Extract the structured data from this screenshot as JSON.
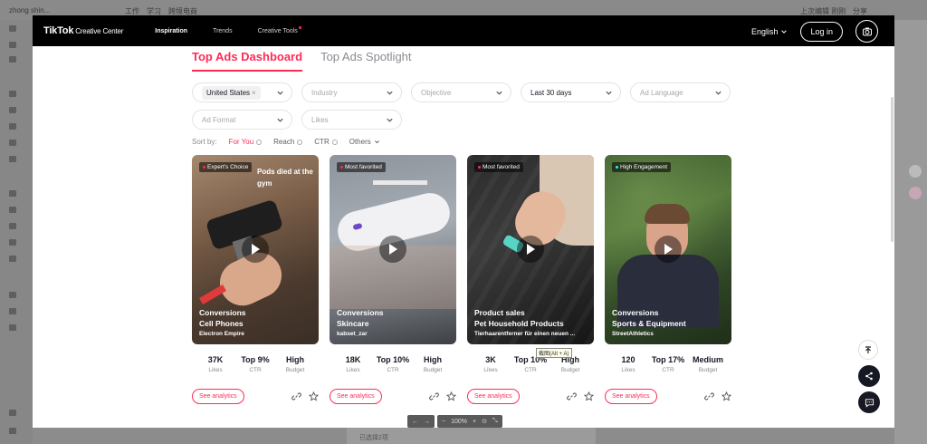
{
  "app": {
    "tab_title": "zhong shin...",
    "menu": [
      "工作",
      "学习",
      "跨境电商"
    ],
    "top_right": [
      "上次编辑 刚刚",
      "分享"
    ],
    "bottom_doc": "已选择2项"
  },
  "header": {
    "logo": "TikTok",
    "logo_sub": "Creative Center",
    "nav": [
      {
        "label": "Inspiration",
        "active": true
      },
      {
        "label": "Trends",
        "active": false
      },
      {
        "label": "Creative Tools",
        "active": false,
        "dot": true
      }
    ],
    "language": "English",
    "login": "Log in"
  },
  "tabs": [
    {
      "label": "Top Ads Dashboard",
      "active": true
    },
    {
      "label": "Top Ads Spotlight",
      "active": false
    }
  ],
  "filters": {
    "country_chip": "United States",
    "industry": "Industry",
    "objective": "Objective",
    "date_range": "Last 30 days",
    "ad_language": "Ad Language",
    "ad_format": "Ad Format",
    "likes": "Likes"
  },
  "sort": {
    "label": "Sort by:",
    "options": [
      "For You",
      "Reach",
      "CTR",
      "Others"
    ]
  },
  "cards": [
    {
      "badge": "Expert's Choice",
      "badge_color": "#fe2c55",
      "overlay": "Pods died at the gym",
      "objective": "Conversions",
      "industry": "Cell Phones",
      "brand": "Electron Empire",
      "likes": "37K",
      "ctr": "Top 9%",
      "budget": "High"
    },
    {
      "badge": "Most favorited",
      "badge_color": "#fe2c55",
      "overlay": "",
      "objective": "Conversions",
      "industry": "Skincare",
      "brand": "kabset_zar",
      "likes": "18K",
      "ctr": "Top 10%",
      "budget": "High"
    },
    {
      "badge": "Most favorited",
      "badge_color": "#fe2c55",
      "overlay": "",
      "objective": "Product sales",
      "industry": "Pet Household Products",
      "brand": "Tierhaarentferner für einen neuen ...",
      "likes": "3K",
      "ctr": "Top 10%",
      "budget": "High"
    },
    {
      "badge": "High Engagement",
      "badge_color": "#25f4ee",
      "overlay": "",
      "objective": "Conversions",
      "industry": "Sports & Equipment",
      "brand": "StreetAthletics",
      "likes": "120",
      "ctr": "Top 17%",
      "budget": "Medium"
    }
  ],
  "stat_labels": {
    "likes": "Likes",
    "ctr": "CTR",
    "budget": "Budget"
  },
  "see_analytics": "See analytics",
  "tooltip": "截图(Alt + A)",
  "zoom": "100%",
  "colors": {
    "accent": "#fe2c55",
    "header_bg": "#000000"
  }
}
